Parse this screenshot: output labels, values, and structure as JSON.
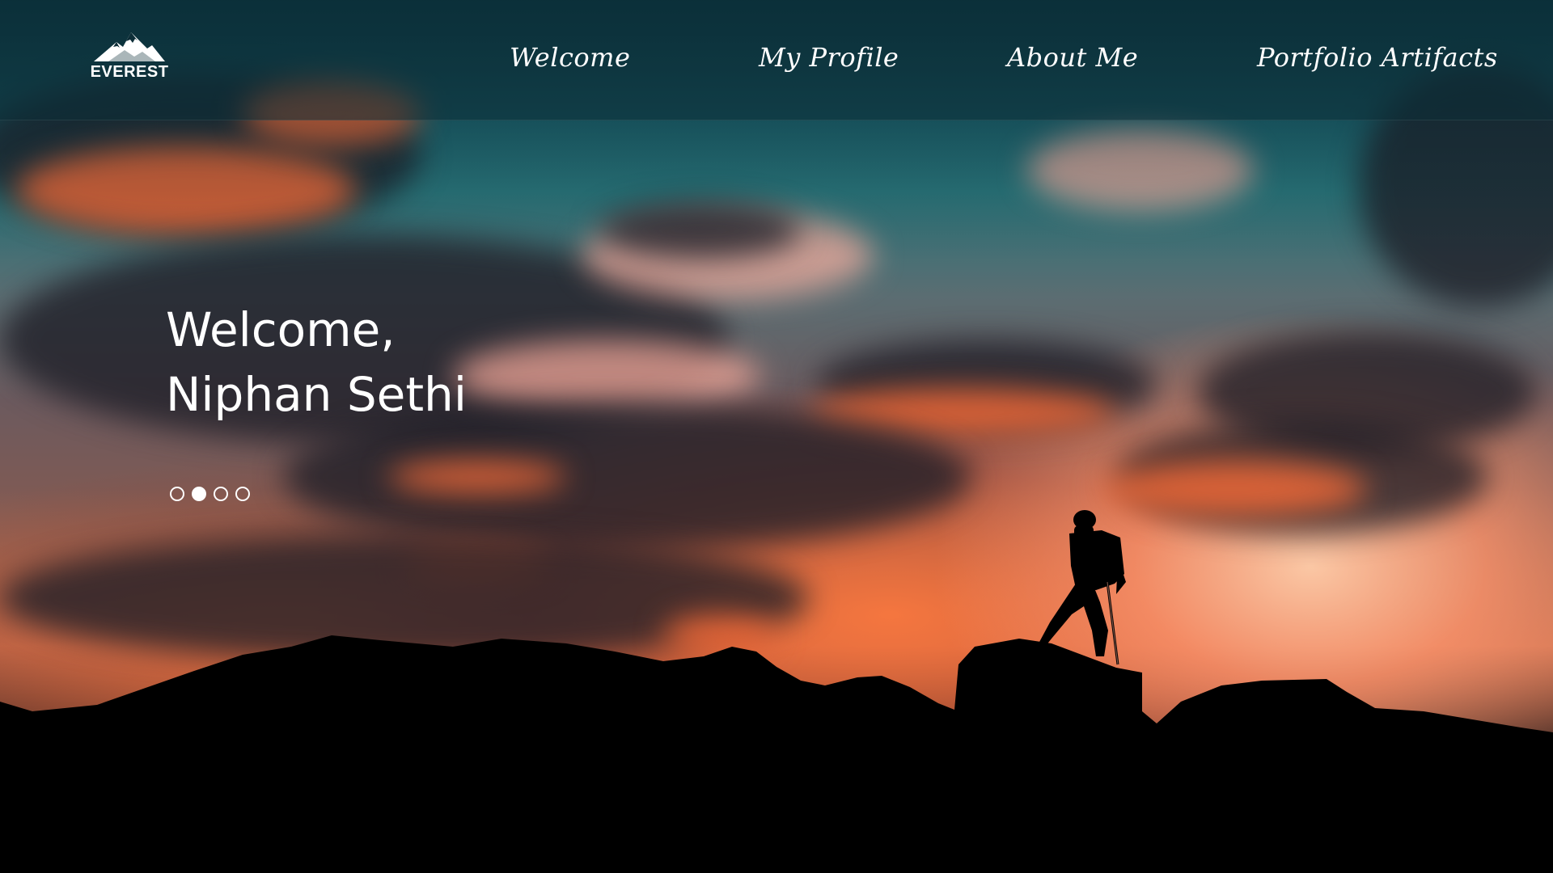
{
  "brand": {
    "logo_icon": "mountain-icon",
    "name": "EVEREST"
  },
  "nav": {
    "items": [
      {
        "label": "Welcome"
      },
      {
        "label": "My Profile"
      },
      {
        "label": "About Me"
      },
      {
        "label": "Portfolio Artifacts"
      }
    ]
  },
  "hero": {
    "line1": "Welcome,",
    "line2": "Niphan Sethi",
    "carousel": {
      "total_slides": 4,
      "active_slide": 2
    }
  },
  "colors": {
    "text": "#ffffff",
    "navbar_bg": "#0c2d37",
    "sky_top": "#0f3f4a",
    "sunset": "#f06937",
    "silhouette": "#000000"
  }
}
